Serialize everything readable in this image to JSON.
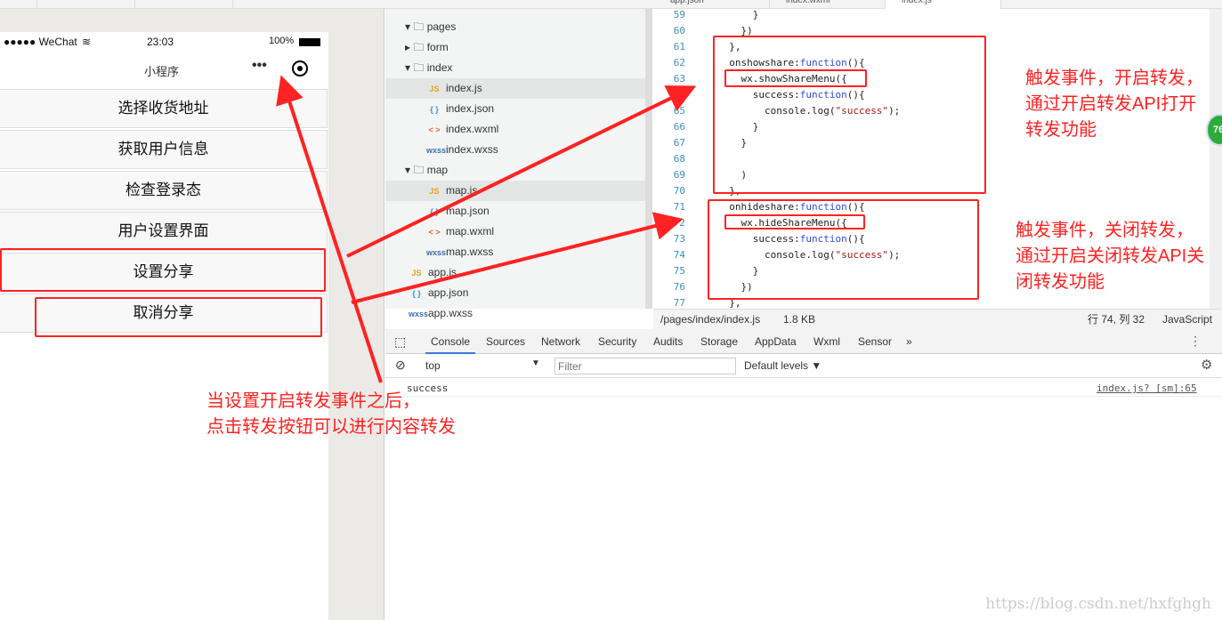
{
  "top_tabs": [
    "",
    "",
    "app.json",
    "index.wxml",
    "index.js"
  ],
  "phone": {
    "carrier": "●●●●● WeChat",
    "wifi_icon": "wifi-icon",
    "time": "23:03",
    "battery": "100%",
    "title": "小程序",
    "buttons": [
      "选择收货地址",
      "获取用户信息",
      "检查登录态",
      "用户设置界面",
      "设置分享",
      "取消分享"
    ]
  },
  "tree": [
    {
      "label": "pages",
      "type": "folder",
      "open": true
    },
    {
      "label": "form",
      "type": "folder",
      "open": false
    },
    {
      "label": "index",
      "type": "folder",
      "open": true
    },
    {
      "label": "index.js",
      "type": "JS",
      "icon": "JS"
    },
    {
      "label": "index.json",
      "type": "json",
      "icon": "{ }"
    },
    {
      "label": "index.wxml",
      "type": "wxml",
      "icon": "< >"
    },
    {
      "label": "index.wxss",
      "type": "wxss",
      "icon": "wxss"
    },
    {
      "label": "map",
      "type": "folder",
      "open": true
    },
    {
      "label": "map.js",
      "type": "JS",
      "icon": "JS"
    },
    {
      "label": "map.json",
      "type": "json",
      "icon": "{ }"
    },
    {
      "label": "map.wxml",
      "type": "wxml",
      "icon": "< >"
    },
    {
      "label": "map.wxss",
      "type": "wxss",
      "icon": "wxss"
    },
    {
      "label": "app.js",
      "type": "JS",
      "icon": "JS"
    },
    {
      "label": "app.json",
      "type": "json",
      "icon": "{ }"
    },
    {
      "label": "app.wxss",
      "type": "wxss",
      "icon": "wxss"
    }
  ],
  "code": {
    "line_numbers": [
      "59",
      "60",
      "61",
      "62",
      "63",
      "64",
      "65",
      "66",
      "67",
      "68",
      "69",
      "70",
      "71",
      "72",
      "73",
      "74",
      "75",
      "76",
      "77"
    ],
    "lines": [
      "      }",
      "    })",
      "  },",
      "  onshowshare:function(){",
      "    wx.showShareMenu({",
      "      success:function(){",
      "        console.log(\"success\");",
      "      }",
      "    }",
      "",
      "    )",
      "  },",
      "  onhideshare:function(){",
      "    wx.hideShareMenu({",
      "      success:function(){",
      "        console.log(\"success\");",
      "      }",
      "    })",
      "  },"
    ]
  },
  "statusbar": {
    "path": "/pages/index/index.js",
    "size": "1.8 KB",
    "position": "行 74, 列 32",
    "language": "JavaScript"
  },
  "devtools": {
    "tabs": [
      "Console",
      "Sources",
      "Network",
      "Security",
      "Audits",
      "Storage",
      "AppData",
      "Wxml",
      "Sensor"
    ],
    "more": "»",
    "context": "top",
    "filter_placeholder": "Filter",
    "levels": "Default levels ▼"
  },
  "console": {
    "message": "success",
    "source": "index.js? [sm]:65"
  },
  "badge": "76",
  "annotations": {
    "show": [
      "触发事件，开启转发，",
      "通过开启转发API打开",
      "转发功能"
    ],
    "hide": [
      "触发事件，关闭转发，",
      "通过开启关闭转发API关",
      "闭转发功能"
    ],
    "share": [
      "当设置开启转发事件之后，",
      "点击转发按钮可以进行内容转发"
    ]
  },
  "watermark": "https://blog.csdn.net/hxfghgh",
  "accent_color": "#ff2222"
}
